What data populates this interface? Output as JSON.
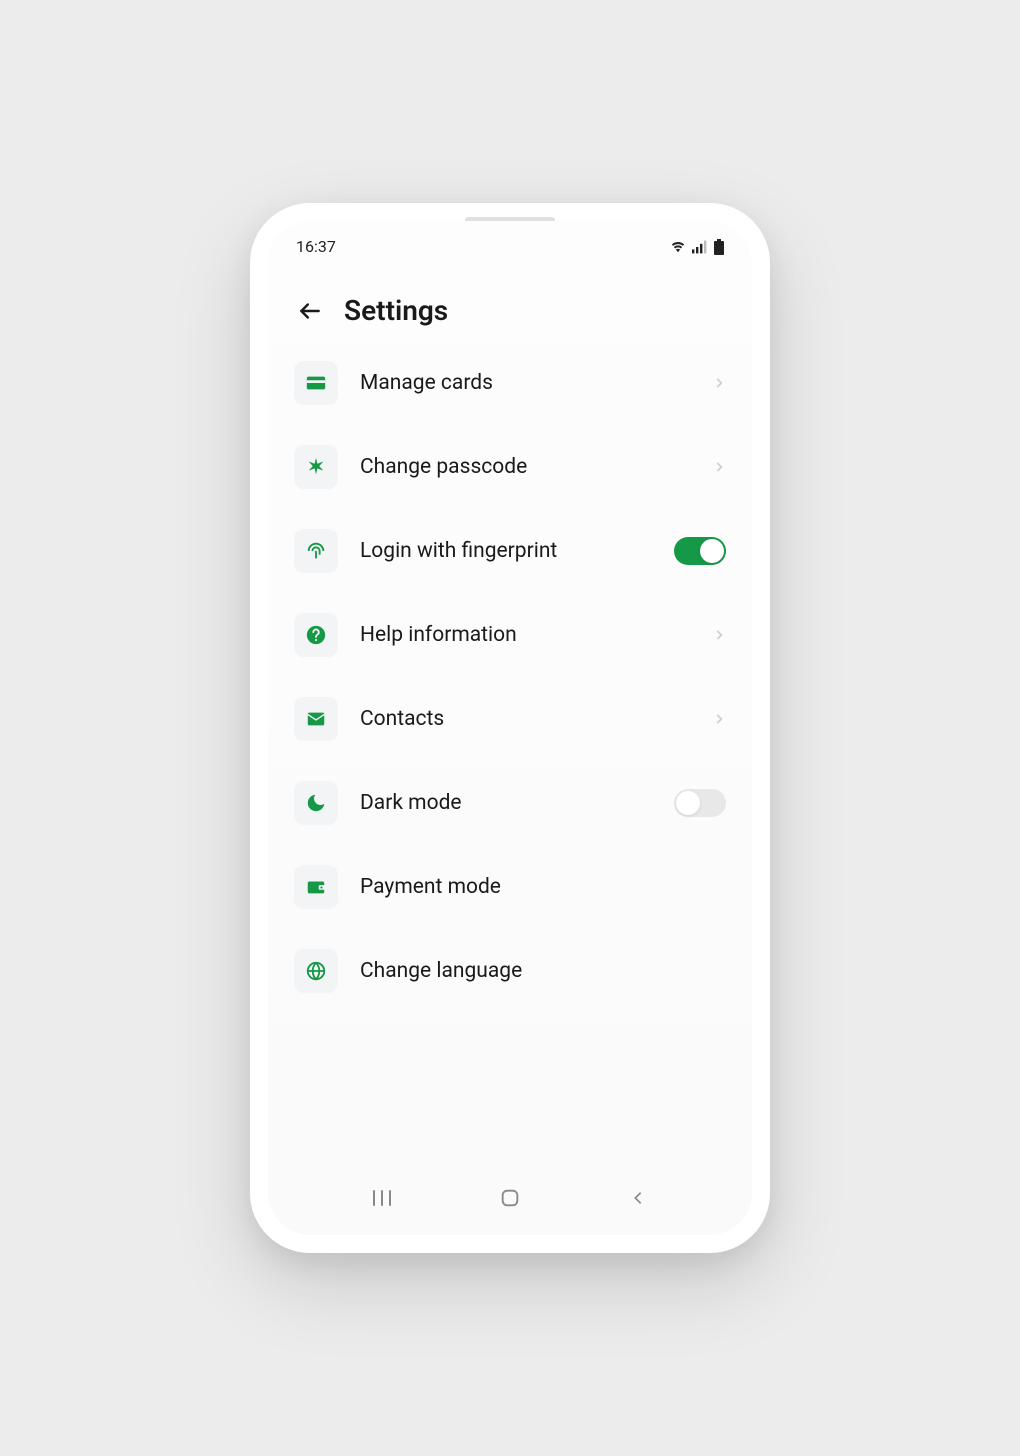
{
  "status": {
    "time": "16:37"
  },
  "header": {
    "title": "Settings"
  },
  "settings": {
    "items": [
      {
        "label": "Manage cards",
        "type": "nav",
        "icon": "card"
      },
      {
        "label": "Change passcode",
        "type": "nav",
        "icon": "asterisk"
      },
      {
        "label": "Login with fingerprint",
        "type": "toggle",
        "state": "on",
        "icon": "fingerprint"
      },
      {
        "label": "Help information",
        "type": "nav",
        "icon": "help"
      },
      {
        "label": "Contacts",
        "type": "nav",
        "icon": "mail"
      },
      {
        "label": "Dark mode",
        "type": "toggle",
        "state": "off",
        "icon": "moon"
      },
      {
        "label": "Payment mode",
        "type": "none",
        "icon": "wallet"
      },
      {
        "label": "Change language",
        "type": "none",
        "icon": "globe"
      }
    ]
  },
  "colors": {
    "accent": "#159947",
    "iconBg": "#f3f4f5"
  }
}
